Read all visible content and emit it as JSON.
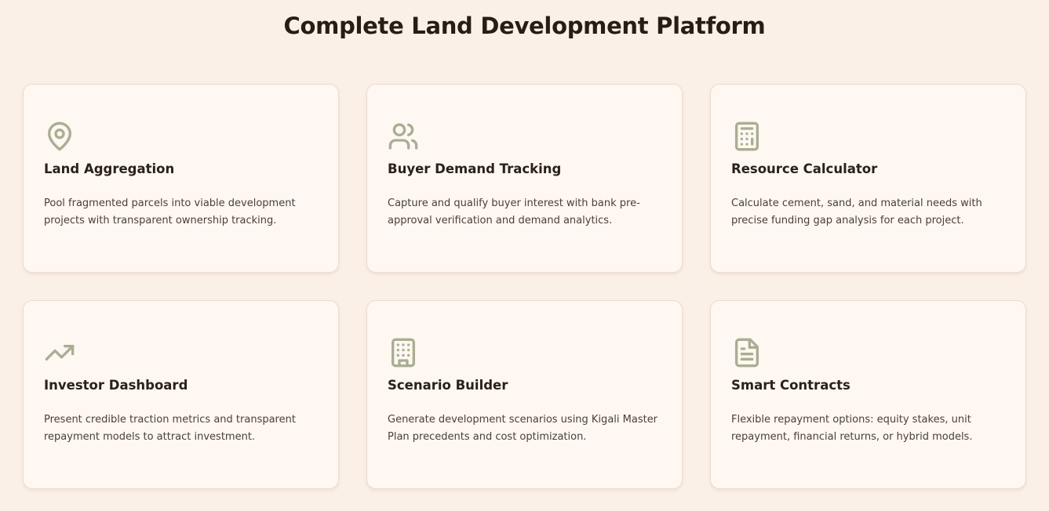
{
  "page": {
    "title": "Complete Land Development Platform"
  },
  "colors": {
    "background": "#fbf0e7",
    "card": "#fff7f2",
    "icon": "#a9ae92",
    "title": "#271d14"
  },
  "features": [
    {
      "icon": "map-pin-icon",
      "title": "Land Aggregation",
      "description": "Pool fragmented parcels into viable development projects with transparent ownership tracking."
    },
    {
      "icon": "users-icon",
      "title": "Buyer Demand Tracking",
      "description": "Capture and qualify buyer interest with bank pre-approval verification and demand analytics."
    },
    {
      "icon": "calculator-icon",
      "title": "Resource Calculator",
      "description": "Calculate cement, sand, and material needs with precise funding gap analysis for each project."
    },
    {
      "icon": "trending-up-icon",
      "title": "Investor Dashboard",
      "description": "Present credible traction metrics and transparent repayment models to attract investment."
    },
    {
      "icon": "building-icon",
      "title": "Scenario Builder",
      "description": "Generate development scenarios using Kigali Master Plan precedents and cost optimization."
    },
    {
      "icon": "file-text-icon",
      "title": "Smart Contracts",
      "description": "Flexible repayment options: equity stakes, unit repayment, financial returns, or hybrid models."
    }
  ]
}
